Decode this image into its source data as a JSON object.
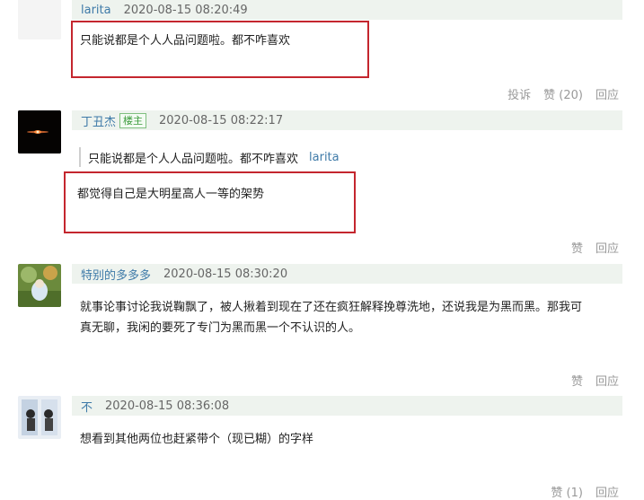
{
  "comments": [
    {
      "author": "larita",
      "time": "2020-08-15 08:20:49",
      "text": "只能说都是个人人品问题啦。都不咋喜欢",
      "actions": {
        "report": "投诉",
        "like": "赞 (20)",
        "reply": "回应"
      }
    },
    {
      "author": "丁丑杰",
      "badge": "楼主",
      "time": "2020-08-15 08:22:17",
      "quote_text": "只能说都是个人人品问题啦。都不咋喜欢",
      "quote_author": "larita",
      "text": "都觉得自己是大明星高人一等的架势",
      "actions": {
        "like": "赞",
        "reply": "回应"
      }
    },
    {
      "author": "特别的多多多",
      "time": "2020-08-15 08:30:20",
      "text_line1": "就事论事讨论我说鞠飘了，被人揪着到现在了还在疯狂解释挽尊洗地，还说我是为黑而黑。那我可",
      "text_line2": "真无聊，我闲的要死了专门为黑而黑一个不认识的人。",
      "actions": {
        "like": "赞",
        "reply": "回应"
      }
    },
    {
      "author": "不",
      "time": "2020-08-15 08:36:08",
      "text": "想看到其他两位也赶紧带个（现已糊）的字样",
      "actions": {
        "like": "赞 (1)",
        "reply": "回应"
      }
    }
  ]
}
